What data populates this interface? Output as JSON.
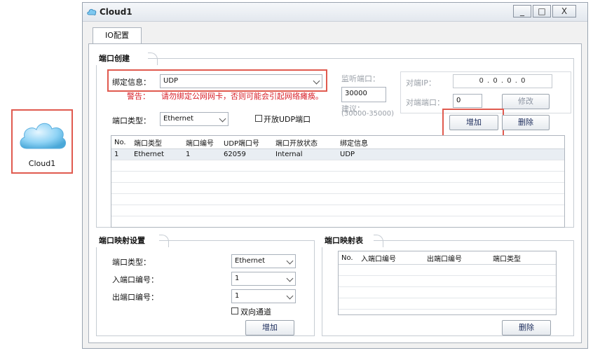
{
  "canvas": {
    "device_label": "Cloud1"
  },
  "window": {
    "title": "Cloud1",
    "controls": {
      "minimize": "_",
      "maximize": "□",
      "close": "X"
    },
    "tab": "IO配置"
  },
  "port_create": {
    "title": "端口创建",
    "bind_label": "绑定信息：",
    "bind_value": "UDP",
    "warn_label": "警告：",
    "warn_text": "请勿绑定公网网卡，否则可能会引起网络瘫痪。",
    "port_type_label": "端口类型：",
    "port_type_value": "Ethernet",
    "open_udp_label": "开放UDP端口",
    "listen_port_label": "监听端口：",
    "listen_port_value": "30000",
    "suggest_label": "建议：",
    "suggest_range": "(30000-35000)",
    "peer_ip_label": "对端IP：",
    "peer_ip_value": "0 . 0 . 0 . 0",
    "peer_port_label": "对端端口：",
    "peer_port_value": "0",
    "modify_btn": "修改",
    "add_btn": "增加",
    "delete_btn": "删除",
    "table": {
      "headers": [
        "No.",
        "端口类型",
        "端口编号",
        "UDP端口号",
        "端口开放状态",
        "绑定信息"
      ],
      "rows": [
        [
          "1",
          "Ethernet",
          "1",
          "62059",
          "Internal",
          "UDP"
        ]
      ]
    }
  },
  "port_map_settings": {
    "title": "端口映射设置",
    "type_label": "端口类型：",
    "type_value": "Ethernet",
    "in_label": "入端口编号：",
    "in_value": "1",
    "out_label": "出端口编号：",
    "out_value": "1",
    "bidir_label": "双向通道",
    "add_btn": "增加"
  },
  "port_map_table": {
    "title": "端口映射表",
    "headers": [
      "No.",
      "入端口编号",
      "出端口编号",
      "端口类型"
    ],
    "delete_btn": "删除"
  },
  "colors": {
    "highlight": "#e05a4f",
    "warning": "#d8202a",
    "cloud": "#7ec8f0"
  },
  "icons": [
    "cloud-icon",
    "chevron-down-icon",
    "checkbox-icon"
  ]
}
